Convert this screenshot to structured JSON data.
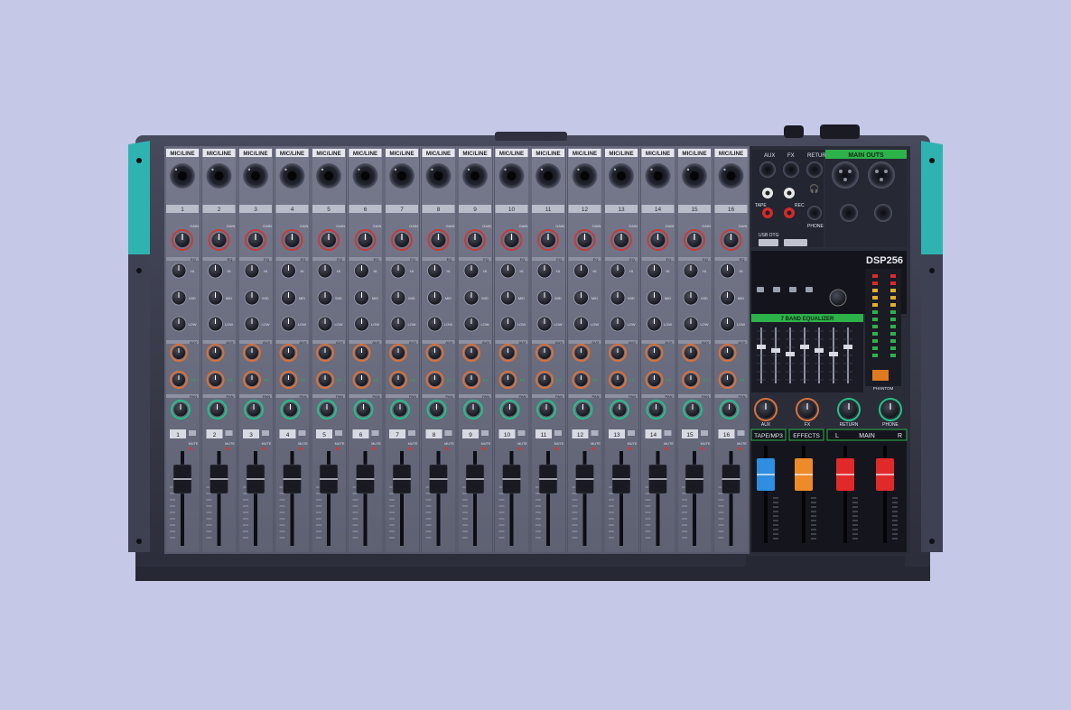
{
  "colors": {
    "background": "#c5c8e6",
    "chassis": "#3a3d4f",
    "panel": "#6b6f80",
    "panel_dark": "#1d1f29",
    "teal_end": "#2fb3b0",
    "accent_green": "#2db24a",
    "pan_knob_ring": "#25c089",
    "aux_knob_ring": "#d9713a",
    "gain_knob_ring": "#c63b3b",
    "fader_blue": "#2f8ee0",
    "fader_orange": "#ee8a2a",
    "fader_red": "#e02a2a"
  },
  "channels": {
    "input_label": "MIC/LINE",
    "numbers": [
      "1",
      "2",
      "3",
      "4",
      "5",
      "6",
      "7",
      "8",
      "9",
      "10",
      "11",
      "12",
      "13",
      "14",
      "15",
      "16"
    ],
    "gain_label": "GAIN",
    "eq_label": "EQ",
    "eq_bands": [
      "HI",
      "MID",
      "LOW"
    ],
    "aux_label": "AUX",
    "fx_label": "FX",
    "pan_label": "PAN",
    "mute_label": "MUTE"
  },
  "master": {
    "jack_labels": [
      "AUX",
      "FX",
      "RETURN"
    ],
    "main_outs_label": "MAIN OUTS",
    "phone_label": "PHONE",
    "tape_label": "TAPE",
    "rec_label": "REC",
    "usb_label": "USB OTG",
    "dsp_title": "DSP256",
    "eq_title": "7 BAND EQUALIZER",
    "knob_labels": [
      "AUX",
      "FX",
      "RETURN",
      "PHONE"
    ],
    "fader_labels": [
      "TAPE/MP3",
      "EFFECTS",
      "MAIN"
    ],
    "main_lr": [
      "L",
      "R"
    ],
    "phantom_label": "PHANTOM"
  }
}
